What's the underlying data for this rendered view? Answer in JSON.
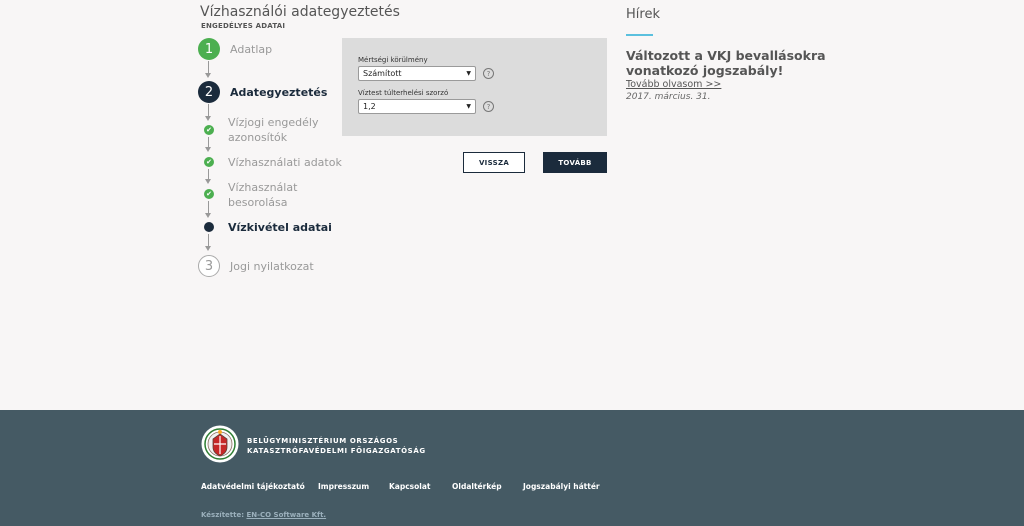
{
  "header": {
    "title": "Vízhasználói adategyeztetés",
    "subtitle": "ENGEDÉLYES ADATAI"
  },
  "steps": [
    {
      "number": "1",
      "label": "Adatlap",
      "state": "done"
    },
    {
      "number": "2",
      "label": "Adategyeztetés",
      "state": "current"
    },
    {
      "number": "3",
      "label": "Jogi nyilatkozat",
      "state": "pending"
    }
  ],
  "substeps": [
    {
      "line1": "Vízjogi engedély",
      "line2": "azonosítók",
      "state": "done"
    },
    {
      "line1": "Vízhasználati adatok",
      "line2": "",
      "state": "done"
    },
    {
      "line1": "Vízhasználat",
      "line2": "besorolása",
      "state": "done"
    },
    {
      "line1": "Vízkivétel adatai",
      "line2": "",
      "state": "current"
    }
  ],
  "form": {
    "field1": {
      "label": "Mértségi körülmény",
      "value": "Számított",
      "help": "?"
    },
    "field2": {
      "label": "Víztest túlterhelési szorzó",
      "value": "1,2",
      "help": "?"
    }
  },
  "buttons": {
    "back": "VISSZA",
    "next": "TOVÁBB"
  },
  "news": {
    "title": "Hírek",
    "headline": "Változott a VKJ bevallásokra vonatkozó jogszabály!",
    "link": "Tovább olvasom >>",
    "date": "2017. március. 31."
  },
  "footer": {
    "org_line1": "BELÜGYMINISZTÉRIUM ORSZÁGOS",
    "org_line2": "KATASZTRÓFAVÉDELMI FŐIGAZGATÓSÁG",
    "links": [
      "Adatvédelmi tájékoztató",
      "Impresszum",
      "Kapcsolat",
      "Oldaltérkép",
      "Jogszabályi háttér"
    ],
    "credit_prefix": "Készítette:",
    "credit_link": "EN-CO Software Kft."
  },
  "colors": {
    "done": "#4caf50",
    "current": "#1b2b3c",
    "footer": "#455a64",
    "accent": "#5bc0de"
  }
}
